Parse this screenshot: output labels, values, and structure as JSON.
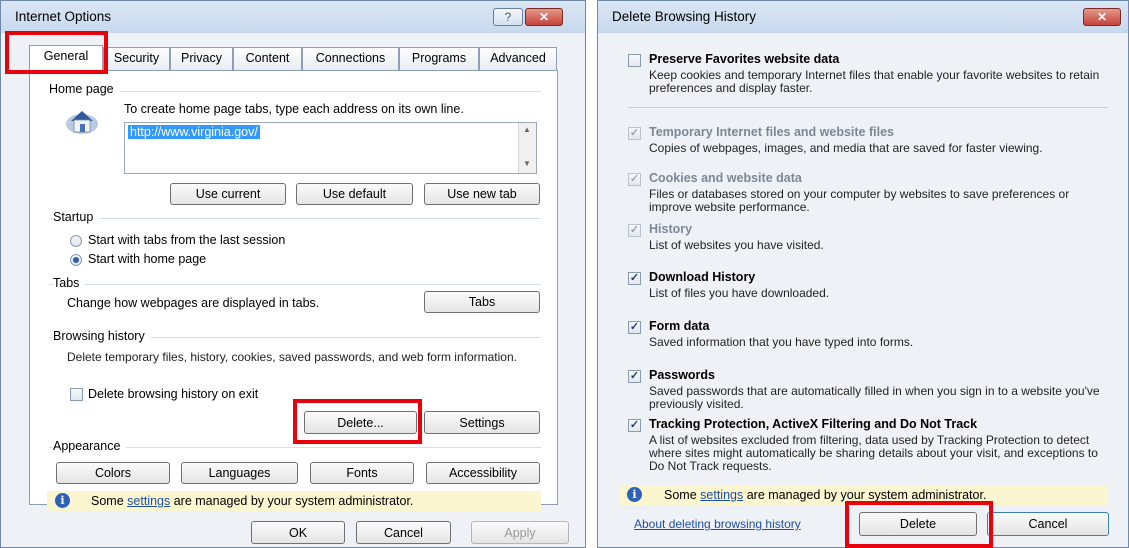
{
  "internet_options": {
    "title": "Internet Options",
    "help_btn": "?",
    "close_btn": "✕",
    "tabs": [
      {
        "label": "General"
      },
      {
        "label": "Security"
      },
      {
        "label": "Privacy"
      },
      {
        "label": "Content"
      },
      {
        "label": "Connections"
      },
      {
        "label": "Programs"
      },
      {
        "label": "Advanced"
      }
    ],
    "home_page": {
      "heading": "Home page",
      "instruction": "To create home page tabs, type each address on its own line.",
      "url": "http://www.virginia.gov/",
      "use_current": "Use current",
      "use_default": "Use default",
      "use_new_tab": "Use new tab"
    },
    "startup": {
      "heading": "Startup",
      "option_last_session": "Start with tabs from the last session",
      "option_home_page": "Start with home page"
    },
    "tabs_group": {
      "heading": "Tabs",
      "description": "Change how webpages are displayed in tabs.",
      "button": "Tabs"
    },
    "browsing_history": {
      "heading": "Browsing history",
      "description": "Delete temporary files, history, cookies, saved passwords, and web form information.",
      "delete_on_exit": "Delete browsing history on exit",
      "delete_button": "Delete...",
      "settings_button": "Settings"
    },
    "appearance": {
      "heading": "Appearance",
      "colors": "Colors",
      "languages": "Languages",
      "fonts": "Fonts",
      "accessibility": "Accessibility"
    },
    "admin_notice": {
      "before": "Some ",
      "link": "settings",
      "after": " are managed by your system administrator."
    },
    "ok": "OK",
    "cancel": "Cancel",
    "apply": "Apply"
  },
  "delete_history": {
    "title": "Delete Browsing History",
    "close_btn": "✕",
    "options": [
      {
        "label": "Preserve Favorites website data",
        "desc": "Keep cookies and temporary Internet files that enable your favorite websites to retain preferences and display faster.",
        "checked": false
      },
      {
        "label": "Temporary Internet files and website files",
        "desc": "Copies of webpages, images, and media that are saved for faster viewing.",
        "checked": true
      },
      {
        "label": "Cookies and website data",
        "desc": "Files or databases stored on your computer by websites to save preferences or improve website performance.",
        "checked": true
      },
      {
        "label": "History",
        "desc": "List of websites you have visited.",
        "checked": true
      },
      {
        "label": "Download History",
        "desc": "List of files you have downloaded.",
        "checked": true
      },
      {
        "label": "Form data",
        "desc": "Saved information that you have typed into forms.",
        "checked": true
      },
      {
        "label": "Passwords",
        "desc": "Saved passwords that are automatically filled in when you sign in to a website you've previously visited.",
        "checked": true
      },
      {
        "label": "Tracking Protection, ActiveX Filtering and Do Not Track",
        "desc": "A list of websites excluded from filtering, data used by Tracking Protection to detect where sites might automatically be sharing details about your visit, and exceptions to Do Not Track requests.",
        "checked": true
      }
    ],
    "admin_notice": {
      "before": "Some ",
      "link": "settings",
      "after": " are managed by your system administrator."
    },
    "about_link": "About deleting browsing history",
    "delete": "Delete",
    "cancel": "Cancel"
  }
}
